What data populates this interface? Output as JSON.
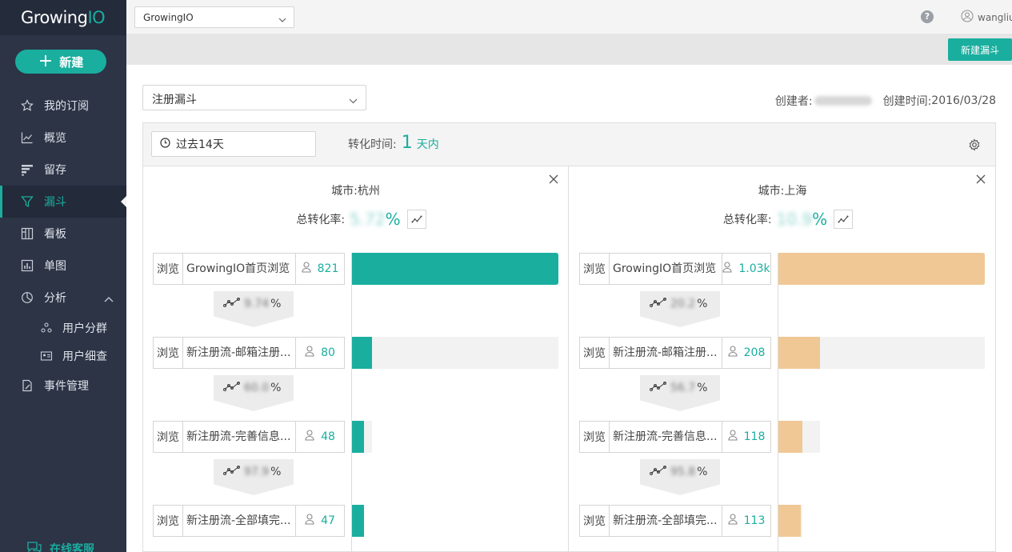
{
  "app": {
    "logo_main": "Growing",
    "logo_accent": "IO"
  },
  "sidebar": {
    "new_label": "新建",
    "items": [
      {
        "label": "我的订阅",
        "icon": "star-icon"
      },
      {
        "label": "概览",
        "icon": "line-chart-icon"
      },
      {
        "label": "留存",
        "icon": "retention-grid-icon"
      },
      {
        "label": "漏斗",
        "icon": "funnel-icon",
        "active": true
      },
      {
        "label": "看板",
        "icon": "dashboard-icon"
      },
      {
        "label": "单图",
        "icon": "bar-chart-icon"
      },
      {
        "label": "分析",
        "icon": "pie-chart-icon"
      }
    ],
    "sub_items": [
      {
        "label": "用户分群",
        "icon": "user-group-icon"
      },
      {
        "label": "用户细查",
        "icon": "user-card-icon"
      }
    ],
    "event_mgmt": "事件管理",
    "online_service": "在线客服"
  },
  "topbar": {
    "project": "GrowingIO",
    "help": "?",
    "username": "wangliu"
  },
  "subbar": {
    "create_funnel": "新建漏斗"
  },
  "main": {
    "funnel_name": "注册漏斗",
    "creator_label": "创建者:",
    "created_time_label": "创建时间:",
    "created_time": "2016/03/28"
  },
  "panel": {
    "date_range": "过去14天",
    "conv_time_label": "转化时间:",
    "conv_time_value": "1",
    "conv_time_unit": "天内"
  },
  "columns": [
    {
      "city_label": "城市:",
      "city": "杭州",
      "rate_label": "总转化率:",
      "rate_value": "5.72",
      "rate_unit": "%",
      "color": "#1aae9f",
      "steps": [
        {
          "type": "浏览",
          "name": "GrowingIO首页浏览",
          "count": "821",
          "fraction": 1.0
        },
        {
          "type": "浏览",
          "name": "新注册流-邮箱注册...",
          "count": "80",
          "fraction": 0.097
        },
        {
          "type": "浏览",
          "name": "新注册流-完善信息...",
          "count": "48",
          "fraction": 0.058
        },
        {
          "type": "浏览",
          "name": "新注册流-全部填完...",
          "count": "47",
          "fraction": 0.057
        }
      ],
      "conversions": [
        {
          "value": "9.74",
          "unit": "%"
        },
        {
          "value": "60.0",
          "unit": "%"
        },
        {
          "value": "97.9",
          "unit": "%"
        }
      ]
    },
    {
      "city_label": "城市:",
      "city": "上海",
      "rate_label": "总转化率:",
      "rate_value": "10.9",
      "rate_unit": "%",
      "color": "#f0c896",
      "steps": [
        {
          "type": "浏览",
          "name": "GrowingIO首页浏览",
          "count": "1.03k",
          "fraction": 1.0
        },
        {
          "type": "浏览",
          "name": "新注册流-邮箱注册...",
          "count": "208",
          "fraction": 0.202
        },
        {
          "type": "浏览",
          "name": "新注册流-完善信息...",
          "count": "118",
          "fraction": 0.115
        },
        {
          "type": "浏览",
          "name": "新注册流-全部填完...",
          "count": "113",
          "fraction": 0.11
        }
      ],
      "conversions": [
        {
          "value": "20.2",
          "unit": "%"
        },
        {
          "value": "56.7",
          "unit": "%"
        },
        {
          "value": "95.8",
          "unit": "%"
        }
      ]
    }
  ]
}
